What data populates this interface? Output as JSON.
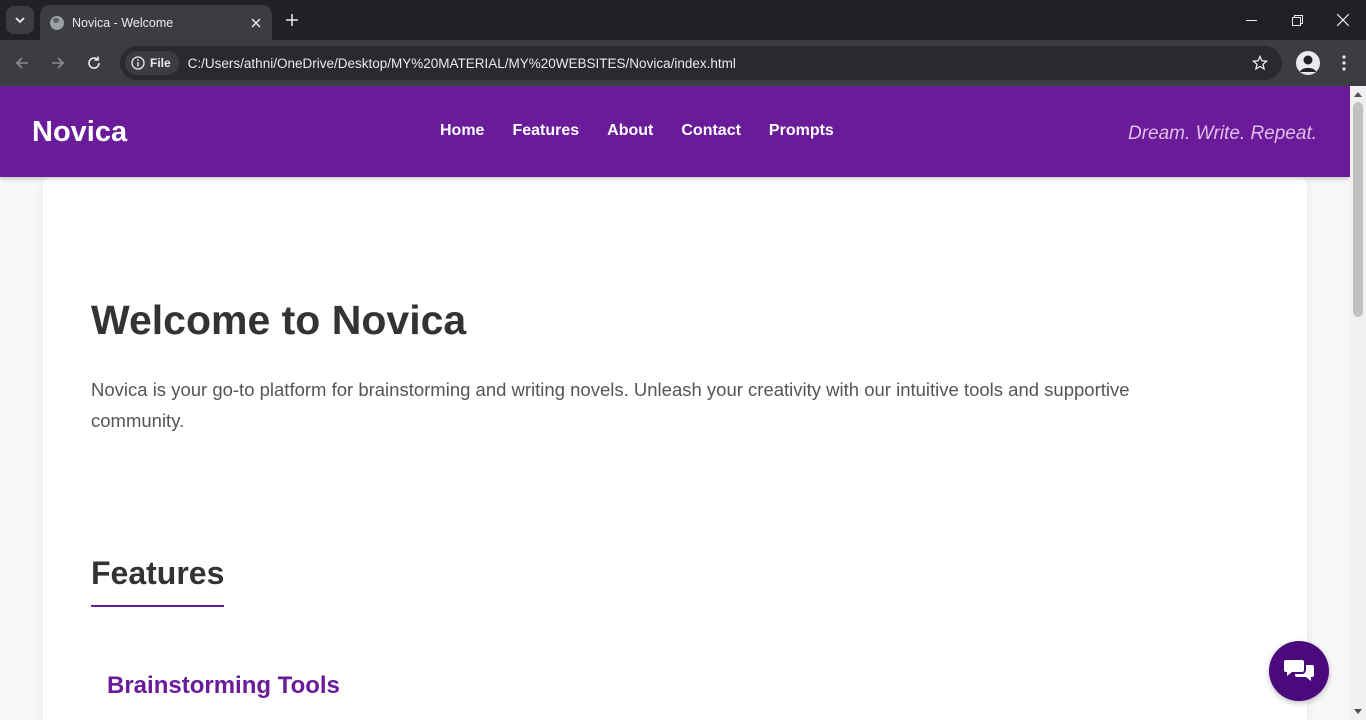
{
  "browser": {
    "tab_title": "Novica - Welcome",
    "chip_label": "File",
    "url": "C:/Users/athni/OneDrive/Desktop/MY%20MATERIAL/MY%20WEBSITES/Novica/index.html"
  },
  "header": {
    "logo": "Novica",
    "nav": [
      "Home",
      "Features",
      "About",
      "Contact",
      "Prompts"
    ],
    "tagline": "Dream. Write. Repeat."
  },
  "hero": {
    "title": "Welcome to Novica",
    "text": "Novica is your go-to platform for brainstorming and writing novels. Unleash your creativity with our intuitive tools and supportive community."
  },
  "features": {
    "title": "Features",
    "items": [
      {
        "title": "Brainstorming Tools"
      }
    ]
  },
  "colors": {
    "brand": "#6a1b9a",
    "fab": "#4a0a7e"
  },
  "icons": [
    "tab-search-icon",
    "globe-icon",
    "close-icon",
    "plus-icon",
    "minimize-icon",
    "restore-icon",
    "back-icon",
    "forward-icon",
    "reload-icon",
    "info-icon",
    "star-icon",
    "profile-icon",
    "kebab-icon",
    "chat-icon"
  ]
}
